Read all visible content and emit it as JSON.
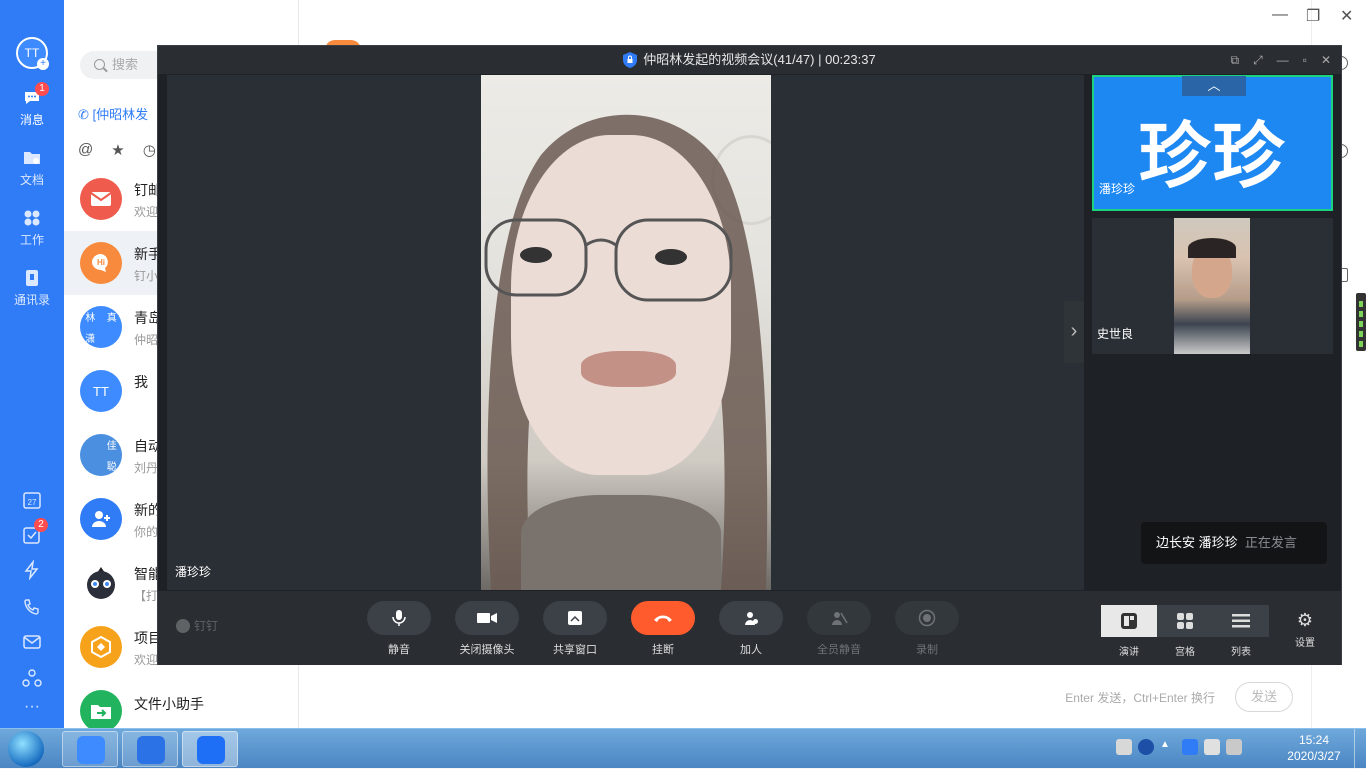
{
  "app_sidebar": {
    "avatar_initials": "TT",
    "items": [
      {
        "label": "消息",
        "icon": "chat-bubble-icon",
        "badge": "1"
      },
      {
        "label": "文档",
        "icon": "folder-icon"
      },
      {
        "label": "工作",
        "icon": "grid-apps-icon"
      },
      {
        "label": "通讯录",
        "icon": "contacts-book-icon"
      }
    ],
    "bottom_items": [
      {
        "icon": "calendar-icon",
        "text": "27"
      },
      {
        "icon": "todo-check-icon",
        "badge": "2"
      },
      {
        "icon": "lightning-icon"
      },
      {
        "icon": "phone-call-icon"
      },
      {
        "icon": "mail-icon"
      },
      {
        "icon": "cloud-network-icon"
      },
      {
        "icon": "more-dots-icon",
        "text": "···"
      }
    ]
  },
  "conv_list": {
    "search_placeholder": "搜索",
    "call_banner": "[仲昭林发",
    "filters": [
      "@",
      "★",
      "◷"
    ],
    "items": [
      {
        "title": "钉邮",
        "sub": "欢迎",
        "color": "#ef5b4c",
        "icon": "mail-icon"
      },
      {
        "title": "新手",
        "sub": "钉小",
        "color": "#f78a3c",
        "icon": "hi-bubble-icon",
        "selected": true
      },
      {
        "title": "青岛",
        "sub": "仲昭",
        "color": "#3d8bff",
        "icon": "group-avatar-icon",
        "chars": [
          "林",
          "真",
          "潇",
          ""
        ]
      },
      {
        "title": "我（",
        "sub": "",
        "color": "#3d8bff",
        "initials": "TT"
      },
      {
        "title": "自动",
        "sub": "刘丹",
        "color": "#4a8fe0",
        "icon": "group-avatar-icon",
        "chars": [
          "",
          "佳",
          "",
          "聪"
        ]
      },
      {
        "title": "新的",
        "sub": "你的",
        "color": "#2f7cf6",
        "icon": "add-friend-icon"
      },
      {
        "title": "智能",
        "sub": "【打",
        "color": "#ffffff",
        "icon": "robot-icon"
      },
      {
        "title": "项目",
        "sub": "欢迎",
        "color": "#f7a21b",
        "icon": "project-icon"
      },
      {
        "title": "文件小助手",
        "sub": "",
        "color": "#22b35e",
        "icon": "file-transfer-icon"
      }
    ]
  },
  "chat": {
    "send_hint": "Enter 发送，Ctrl+Enter 换行",
    "send_label": "发送"
  },
  "meeting": {
    "title": "仲昭林发起的视频会议(41/47) | 00:23:37",
    "main_speaker": "潘珍珍",
    "thumbnails": [
      {
        "name": "潘珍珍",
        "big_text": "珍珍",
        "active": true
      },
      {
        "name": "史世良",
        "active": false
      }
    ],
    "speaking": {
      "names": "边长安  潘珍珍",
      "status": "正在发言"
    },
    "logo_text": "钉钉",
    "toolbar": [
      {
        "label": "静音",
        "icon": "microphone-icon"
      },
      {
        "label": "关闭摄像头",
        "icon": "camera-icon"
      },
      {
        "label": "共享窗口",
        "icon": "share-screen-icon"
      },
      {
        "label": "挂断",
        "icon": "hang-up-icon",
        "danger": true
      },
      {
        "label": "加人",
        "icon": "add-person-icon"
      },
      {
        "label": "全员静音",
        "icon": "mute-all-icon",
        "disabled": true
      },
      {
        "label": "录制",
        "icon": "record-icon",
        "disabled": true
      }
    ],
    "views": [
      {
        "label": "演讲",
        "active": true
      },
      {
        "label": "宫格",
        "active": false
      },
      {
        "label": "列表",
        "active": false
      }
    ],
    "settings_label": "设置"
  },
  "taskbar": {
    "time": "15:24",
    "date": "2020/3/27"
  }
}
